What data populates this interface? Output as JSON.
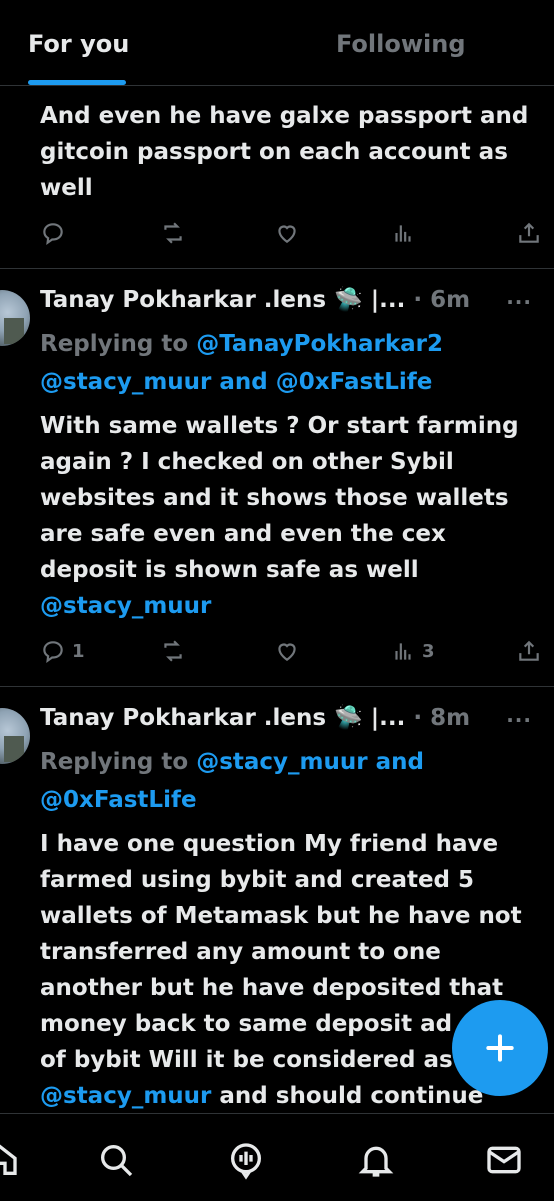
{
  "tabs": {
    "for_you": "For you",
    "following": "Following"
  },
  "tweet1": {
    "lines": [
      "And  even he have galxe passport and",
      "gitcoin passport on each account as",
      "well"
    ]
  },
  "tweet2": {
    "author": "Tanay Pokharkar .lens 🛸 |...",
    "time": "· 6m",
    "replying_prefix": "Replying to",
    "replying_line1_mention": "@TanayPokharkar2",
    "replying_line2_mention1": "@stacy_muur",
    "replying_line2_and": "and",
    "replying_line2_mention2": "@0xFastLife",
    "lines": [
      "With same wallets ? Or start farming",
      "again ? I checked on other Sybil",
      "websites and it shows those wallets",
      "are safe even and even the cex",
      "deposit is shown safe as well"
    ],
    "trailing_mention": "@stacy_muur",
    "reply_count": "1",
    "views_count": "3"
  },
  "tweet3": {
    "author": "Tanay Pokharkar .lens 🛸 |...",
    "time": "· 8m",
    "replying_prefix": "Replying to",
    "replying_line1_mention1": "@stacy_muur",
    "replying_line1_and": "and",
    "replying_line2_mention": "@0xFastLife",
    "lines": [
      "I have one question My friend have",
      "farmed using bybit and created 5",
      "wallets of Metamask but he have not",
      "transferred any amount to one",
      "another but he have deposited that",
      "money back to same deposit ad",
      "of bybit Will it be considered as"
    ],
    "last_line_mention": "@stacy_muur",
    "last_line_text": "and should continue"
  },
  "more_label": "···",
  "compose_icon": "plus-icon",
  "nav": [
    "home-icon",
    "search-icon",
    "spaces-icon",
    "notifications-icon",
    "messages-icon"
  ],
  "colors": {
    "accent": "#1d9bf0",
    "text": "#e7e9ea",
    "muted": "#71767b",
    "background": "#000000",
    "divider": "#2f3336"
  }
}
